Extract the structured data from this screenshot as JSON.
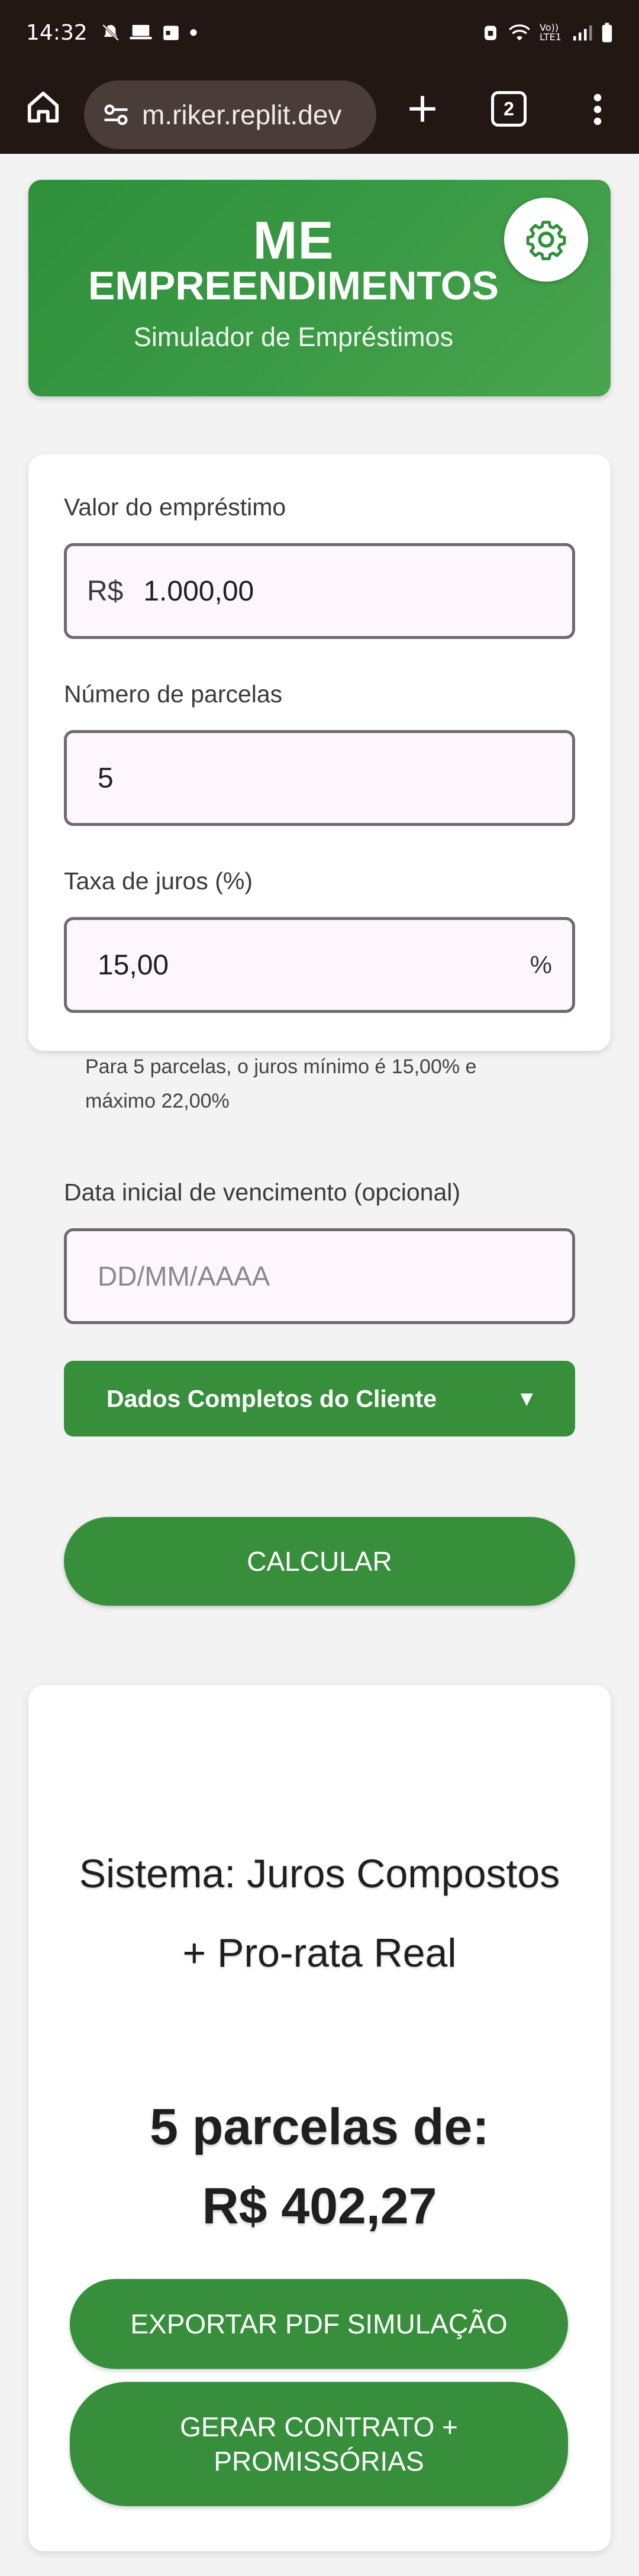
{
  "status_bar": {
    "time": "14:32",
    "network": "Vo)) LTE1"
  },
  "browser": {
    "url": "m.riker.replit.dev",
    "tab_count": "2"
  },
  "header": {
    "brand_line1": "ME",
    "brand_line2": "EMPREENDIMENTOS",
    "subtitle": "Simulador de Empréstimos"
  },
  "form": {
    "loan_label": "Valor do empréstimo",
    "loan_prefix": "R$",
    "loan_value": "1.000,00",
    "installments_label": "Número de parcelas",
    "installments_value": "5",
    "interest_label": "Taxa de juros (%)",
    "interest_value": "15,00",
    "interest_suffix": "%",
    "interest_hint": "Para 5 parcelas, o juros mínimo é 15,00% e máximo 22,00%",
    "due_date_label": "Data inicial de vencimento (opcional)",
    "due_date_placeholder": "DD/MM/AAAA",
    "client_dropdown_label": "Dados Completos do Cliente",
    "client_dropdown_caret": "▼",
    "calculate_label": "CALCULAR"
  },
  "result": {
    "system_text": "Sistema: Juros Compostos + Pro-rata Real",
    "installments_line": "5 parcelas de:",
    "installment_amount": "R$ 402,27",
    "export_pdf_label": "EXPORTAR PDF SIMULAÇÃO",
    "contract_label": "GERAR CONTRATO + PROMISSÓRIAS"
  },
  "colors": {
    "primary_green": "#378f3c",
    "header_gradient_start": "#2f8f3a",
    "header_gradient_end": "#4aa54f",
    "browser_bar": "#231714",
    "input_background": "#fdf7fd"
  }
}
